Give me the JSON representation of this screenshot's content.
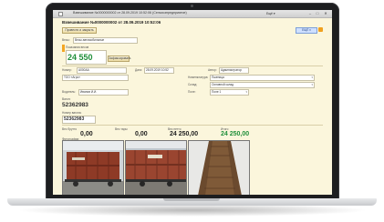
{
  "window": {
    "title": "Взвешивание №0000000002 от 28.09.2019 10:52:06 (Сельхозпредприятие)",
    "extra": "Ещё ▾",
    "controls": [
      "–",
      "□",
      "✕"
    ]
  },
  "document": {
    "title": "Взвешивание №0000000002 от 28.09.2019 10:52:06",
    "post_button": "Провести и закрыть",
    "report_badge": "ЕЩЁ ▾"
  },
  "weighing": {
    "scale_label": "Весы:",
    "scale_value": "Весы автомобильные",
    "weight_label": "Показания весов",
    "weight_value": "24 550",
    "capture_button": "Зафиксировать"
  },
  "fields": {
    "vehicle_label": "Номер:",
    "vehicle_value": "А000АА",
    "date_label": "Дата:",
    "date_value": "28.09.2019 10:52",
    "author_label": "Автор:",
    "author_value": "Администратор",
    "counterparty_label": "Контрагент:",
    "counterparty_value": "ТОО «Агро»",
    "nomenclature_label": "Номенклатура:",
    "nomenclature_value": "Пшеница",
    "driver_label": "Водитель:",
    "driver_value": "Иванов И.И.",
    "wagon_label": "Вагон:",
    "wagon_value": "52362983",
    "car_label": "Номер вагона:",
    "car_value": "52362983",
    "field_label": "Поле:",
    "field_value": "Поле 1",
    "warehouse_label": "Склад:",
    "warehouse_value": "Основной склад",
    "comment_label": "Комментарий:",
    "comment_value": ""
  },
  "totals": {
    "gross_label": "Вес брутто",
    "gross_value": "0,00",
    "tare_label": "Вес тары",
    "tare_value": "0,00",
    "net_label": "Вес нетто",
    "net_value": "24 250,00",
    "result_label": "Итого",
    "result_value": "24 250,00"
  },
  "photos": {
    "label": "Фотографии:",
    "items": [
      "photo-1",
      "photo-2",
      "photo-3"
    ]
  }
}
